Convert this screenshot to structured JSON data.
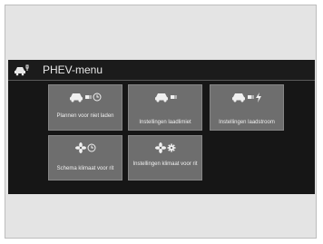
{
  "header": {
    "icon": "ev-car-menu-icon",
    "title": "PHEV-menu"
  },
  "tiles": [
    {
      "label": "Plannen voor niet laden",
      "icons": [
        "car-icon",
        "plug-icon",
        "clock-icon"
      ]
    },
    {
      "label": "Instellingen laadlimiet",
      "icons": [
        "car-icon",
        "plug-icon"
      ]
    },
    {
      "label": "Instellingen laadstroom",
      "icons": [
        "car-icon",
        "plug-icon",
        "lightning-icon"
      ]
    },
    {
      "label": "Schema klimaat voor rit",
      "icons": [
        "fan-icon",
        "clock-icon"
      ]
    },
    {
      "label": "Instellingen klimaat voor rit",
      "icons": [
        "fan-icon",
        "gear-icon"
      ]
    }
  ],
  "colors": {
    "screen": "#161616",
    "tile": "#6e6e6e",
    "text": "#e8e8e8"
  }
}
